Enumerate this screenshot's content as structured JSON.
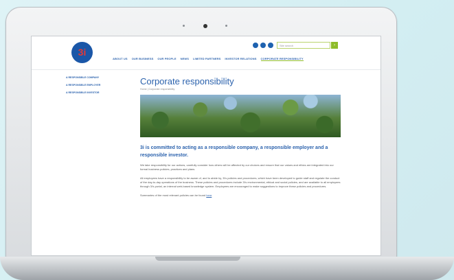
{
  "site": {
    "logo_text": "3i",
    "search_placeholder": "Site search",
    "search_button": "›",
    "nav": [
      {
        "label": "ABOUT US"
      },
      {
        "label": "OUR BUSINESS"
      },
      {
        "label": "OUR PEOPLE"
      },
      {
        "label": "NEWS"
      },
      {
        "label": "LIMITED PARTNERS"
      },
      {
        "label": "INVESTOR RELATIONS"
      },
      {
        "label": "CORPORATE RESPONSIBILITY"
      }
    ],
    "sidebar": [
      {
        "label": "A RESPONSIBLE COMPANY"
      },
      {
        "label": "A RESPONSIBLE EMPLOYER"
      },
      {
        "label": "A RESPONSIBLE INVESTOR"
      }
    ],
    "page_title": "Corporate responsibility",
    "breadcrumb": "Home  |  Corporate responsibility",
    "intro": "3i is committed to acting as a responsible company, a responsible employer and a responsible investor.",
    "para1": "We take responsibility for our actions, carefully consider how others will be affected by our choices and ensure that our values and ethics are integrated into our formal business policies, practices and plans.",
    "para2": "All employees have a responsibility to be aware of, and to abide by, 3i's policies and procedures, which have been developed to guide staff and regulate the conduct of the day-to-day operations of the business. These policies and procedures include 3i's environmental, ethical and social policies, and are available to all employees through 3i's portal, an internal web-based knowledge system. Employees are encouraged to make suggestions to improve these policies and procedures.",
    "para3_prefix": "Summaries of the most relevant policies can be found ",
    "para3_link": "here",
    "para3_suffix": "."
  },
  "colors": {
    "brand_blue": "#2b62ad",
    "accent_green": "#8ebc2a"
  }
}
